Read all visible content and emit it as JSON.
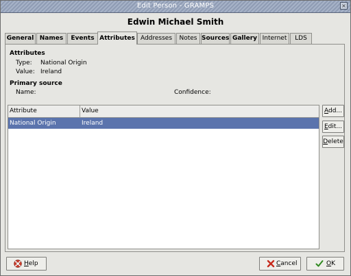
{
  "window": {
    "title": "Edit Person - GRAMPS",
    "close_glyph": "×"
  },
  "person": {
    "name": "Edwin Michael Smith"
  },
  "tabs": [
    {
      "label": "General"
    },
    {
      "label": "Names"
    },
    {
      "label": "Events"
    },
    {
      "label": "Attributes"
    },
    {
      "label": "Addresses"
    },
    {
      "label": "Notes"
    },
    {
      "label": "Sources"
    },
    {
      "label": "Gallery"
    },
    {
      "label": "Internet"
    },
    {
      "label": "LDS"
    }
  ],
  "attributes_section": {
    "title": "Attributes",
    "type_label": "Type:",
    "type_value": "National Origin",
    "value_label": "Value:",
    "value_value": "Ireland"
  },
  "primary_source": {
    "title": "Primary source",
    "name_label": "Name:",
    "confidence_label": "Confidence:"
  },
  "list": {
    "columns": [
      "Attribute",
      "Value"
    ],
    "rows": [
      {
        "attribute": "National Origin",
        "value": "Ireland",
        "selected": true
      }
    ]
  },
  "side_buttons": {
    "add": {
      "mnemonic": "A",
      "rest": "dd..."
    },
    "edit": {
      "mnemonic": "E",
      "rest": "dit..."
    },
    "delete": {
      "mnemonic": "D",
      "rest": "elete"
    }
  },
  "bottom_buttons": {
    "help": {
      "mnemonic": "H",
      "rest": "elp",
      "icon": "help-lifebuoy-icon"
    },
    "cancel": {
      "mnemonic": "C",
      "rest": "ancel",
      "icon": "cancel-x-icon"
    },
    "ok": {
      "mnemonic": "O",
      "rest": "K",
      "icon": "ok-check-icon"
    }
  },
  "colors": {
    "selection": "#5b74ad",
    "titlebar": "#8f9cb4"
  }
}
